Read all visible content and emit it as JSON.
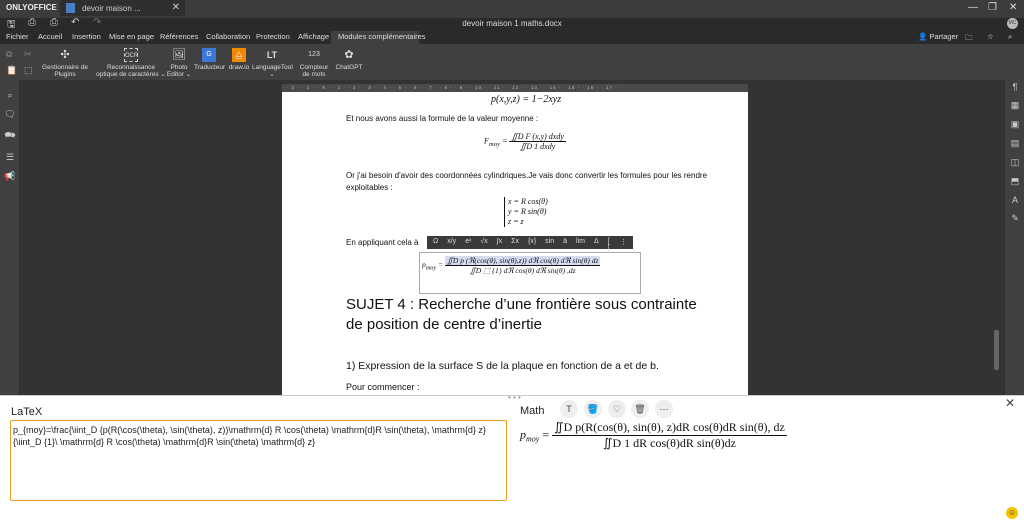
{
  "app": {
    "name": "ONLYOFFICE",
    "tab_title": "devoir maison ...",
    "doc_title": "devoir maison 1 maths.docx",
    "avatar": "MC"
  },
  "window_controls": {
    "minimize": "—",
    "restore": "❐",
    "close": "✕"
  },
  "quick_access": [
    "save",
    "print",
    "quick-print",
    "undo",
    "redo"
  ],
  "menu": [
    "Fichier",
    "Accueil",
    "Insertion",
    "Mise en page",
    "Références",
    "Collaboration",
    "Protection",
    "Affichage",
    "Modules complémentaires"
  ],
  "header_right": {
    "share": "Partager"
  },
  "toolbar": [
    {
      "label": "Gestionnaire de Plugins",
      "icon": "puzzle-icon"
    },
    {
      "label": "Reconnaissance optique de caractères ⌄",
      "icon": "ocr-icon"
    },
    {
      "label": "Photo Editor ⌄",
      "icon": "photo-editor-icon"
    },
    {
      "label": "Traducteur",
      "icon": "translator-icon"
    },
    {
      "label": "draw.io",
      "icon": "drawio-icon"
    },
    {
      "label": "LanguageTool ⌄",
      "icon": "languagetool-icon"
    },
    {
      "label": "Compteur de mots",
      "icon": "word-counter-icon"
    },
    {
      "label": "ChatGPT",
      "icon": "chatgpt-icon"
    }
  ],
  "ruler": "· · 2 · · 1 · · X · · 1 · · 2 · · 3 · · 4 · · 5 · · 6 · · 7 · · 8 · · 9 · · 10 · · 11 · · 12 · · 13 · · 14 · · 15 · · 16 · · 17 · ·",
  "document": {
    "eq1": "p(x,y,z) = 1−2xyz",
    "p1": "Et nous avons aussi la formule de la valeur moyenne :",
    "eq2_lhs": "F",
    "eq2_sub": "moy",
    "eq2_num": "∬D F (x,y) dxdy",
    "eq2_den": "∬D 1 dxdy",
    "p2": "Or j'ai besoin d'avoir des coordonnées cylindriques.Je vais donc convertir les formules pour les rendre exploitables :",
    "sys": [
      "x = R cos(θ)",
      "y = R sin(θ)",
      "z = z"
    ],
    "p3": "En appliquant cela à",
    "eq3_lhs": "p",
    "eq3_sub": "moy",
    "eq3_num": "∬D p (ℜ(cos(θ), sin(θ),z)) dℜ cos(θ) dℜ sin(θ) dz",
    "eq3_den": "∬D ⬚ {1} dℜ cos(θ) dℜ sin(θ) ,dz",
    "heading": "SUJET 4 : Recherche d’une frontière sous contrainte de position de centre d’inertie",
    "p4": "1) Expression de la surface S de la plaque en fonction de a et de b.",
    "p5": "Pour commencer :"
  },
  "equation_toolbar": [
    "Ω",
    "x/y",
    "eˣ",
    "√x",
    "∫x",
    "Σx",
    "{x}",
    "sin",
    "ä",
    "lim",
    "Δ",
    "[ ]",
    "⋮"
  ],
  "panel": {
    "latex_label": "LaTeX",
    "latex_value": "p_{moy}=\\frac{\\iint_D {p(R(\\cos(\\theta), \\sin(\\theta), z))\\mathrm{d} R \\cos(\\theta) \\mathrm{d}R \\sin(\\theta), \\mathrm{d} z}{\\iint_D {1}\\ \\mathrm{d} R \\cos(\\theta) \\mathrm{d}R \\sin(\\theta) \\mathrm{d} z}",
    "math_label": "Math",
    "math_buttons": [
      "T",
      "🪣",
      "♡",
      "🗑",
      "⋯"
    ],
    "render_lhs": "p",
    "render_sub": "moy",
    "render_num": "∬D p(R(cos(θ), sin(θ), z)dR cos(θ)dR sin(θ), dz",
    "render_den": "∬D 1 dR cos(θ)dR sin(θ)dz",
    "close": "✕"
  }
}
